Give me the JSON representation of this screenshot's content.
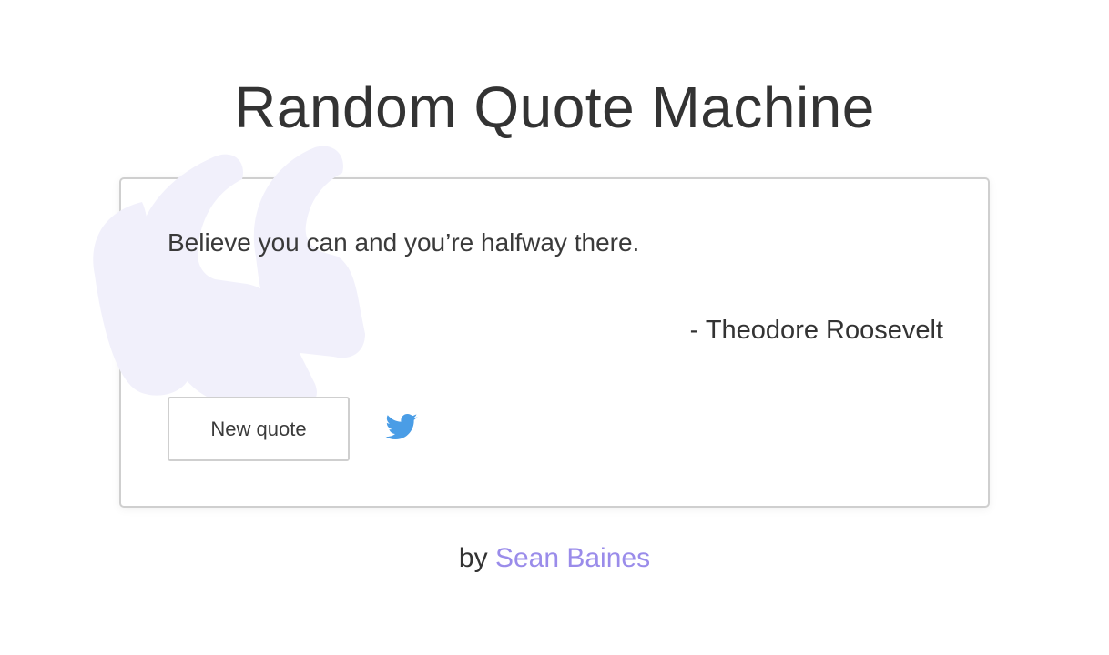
{
  "header": {
    "title": "Random Quote Machine"
  },
  "quote": {
    "text": "Believe you can and you’re halfway there.",
    "author": "- Theodore Roosevelt"
  },
  "actions": {
    "new_quote_label": "New quote",
    "tweet_icon": "twitter-bird-icon"
  },
  "footer": {
    "by_label": "by",
    "author_link": "Sean Baines"
  },
  "colors": {
    "accent": "#9a8cea",
    "quote_mark": "#f1f0fb",
    "twitter": "#4a9de6",
    "border": "#cfcfcf",
    "text": "#333333"
  }
}
